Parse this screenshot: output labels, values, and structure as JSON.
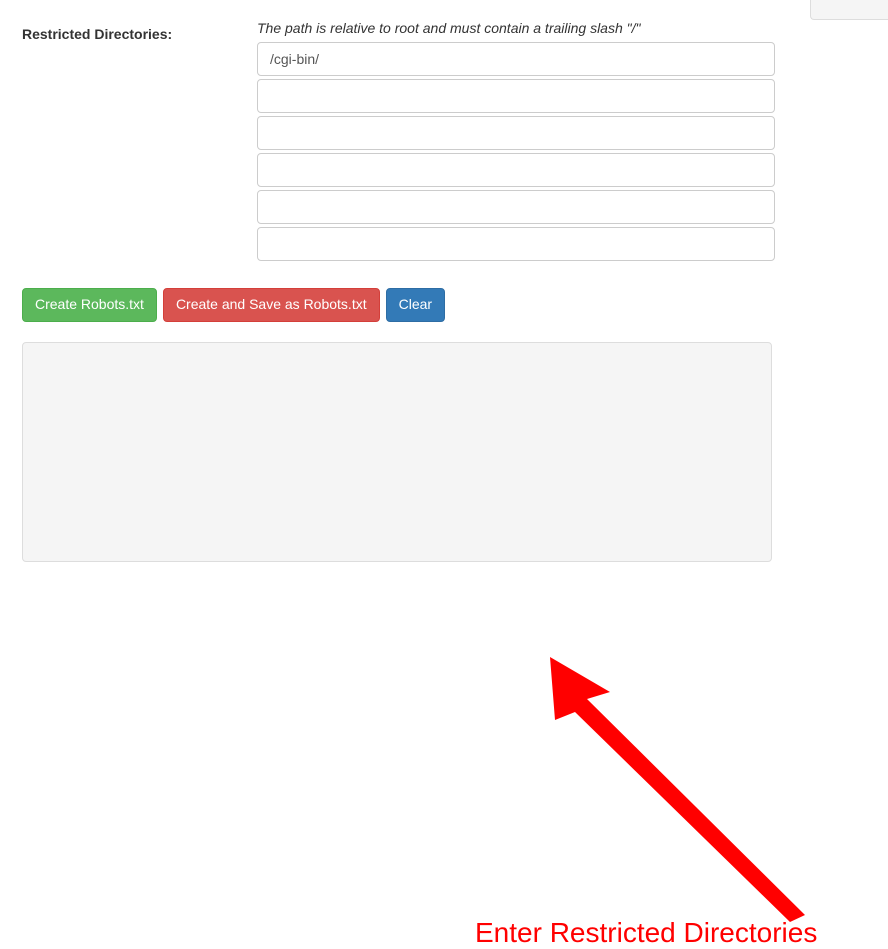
{
  "form": {
    "label": "Restricted Directories:",
    "hint": "The path is relative to root and must contain a trailing slash \"/\"",
    "inputs": [
      {
        "value": "/cgi-bin/"
      },
      {
        "value": ""
      },
      {
        "value": ""
      },
      {
        "value": ""
      },
      {
        "value": ""
      },
      {
        "value": ""
      }
    ]
  },
  "buttons": {
    "create": "Create Robots.txt",
    "createSave": "Create and Save as Robots.txt",
    "clear": "Clear"
  },
  "annotation": {
    "text": "Enter Restricted Directories"
  }
}
